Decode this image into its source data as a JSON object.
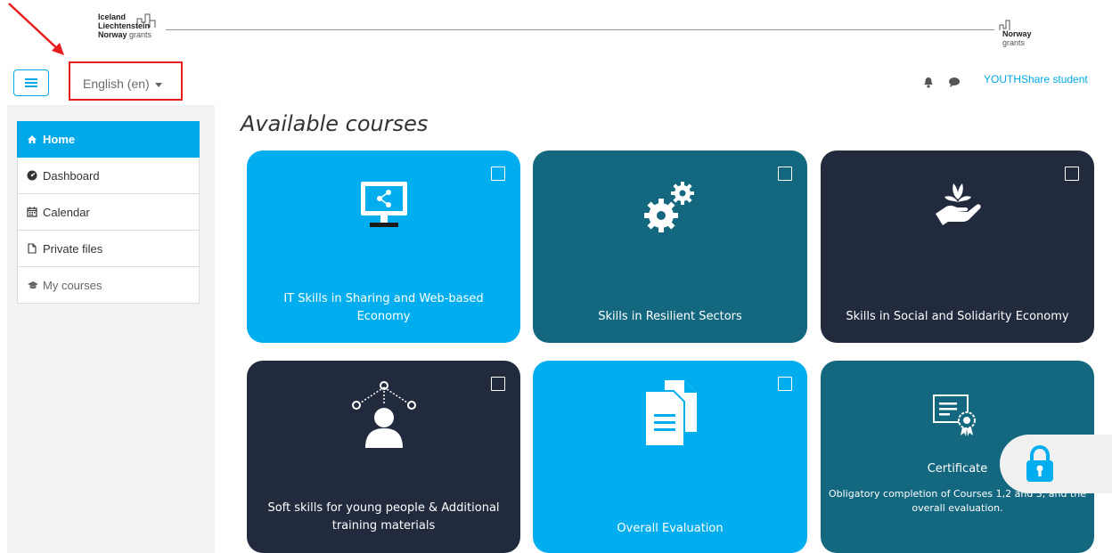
{
  "header": {
    "logo_left_lines": [
      "Iceland",
      "Liechtenstein",
      "Norway"
    ],
    "logo_left_suffix": "grants",
    "logo_right_line": "Norway",
    "logo_right_suffix": "grants"
  },
  "navbar": {
    "menu_toggle_icon": "hamburger-icon",
    "language": "English (en)",
    "user_name": "YOUTHShare student"
  },
  "sidebar": {
    "items": [
      {
        "label": "Home",
        "icon": "home-icon"
      },
      {
        "label": "Dashboard",
        "icon": "dashboard-icon"
      },
      {
        "label": "Calendar",
        "icon": "calendar-icon"
      },
      {
        "label": "Private files",
        "icon": "file-icon"
      },
      {
        "label": "My courses",
        "icon": "graduation-cap-icon"
      }
    ]
  },
  "main": {
    "title": "Available courses",
    "courses": [
      {
        "label": "IT Skills in Sharing and Web-based Economy",
        "icon": "monitor-share-icon",
        "color": "#00aeef"
      },
      {
        "label": "Skills in Resilient Sectors",
        "icon": "gears-icon",
        "color": "#13677e"
      },
      {
        "label": "Skills in Social and Solidarity Economy",
        "icon": "hand-plant-icon",
        "color": "#222a3e"
      },
      {
        "label": "Soft skills for young people & Additional training materials",
        "icon": "person-network-icon",
        "color": "#222a3e"
      },
      {
        "label": "Overall Evaluation",
        "icon": "documents-icon",
        "color": "#00aeef"
      }
    ],
    "certificate": {
      "title": "Certificate",
      "description": "Obligatory completion of Courses 1,2 and 3, and the overall evaluation.",
      "icon": "certificate-icon",
      "color": "#13677e"
    }
  },
  "colors": {
    "accent": "#00a8e8",
    "highlight_box": "#e81c1c"
  }
}
